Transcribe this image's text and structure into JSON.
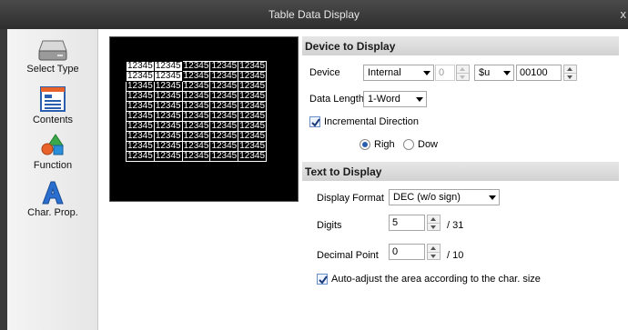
{
  "window": {
    "title": "Table Data Display",
    "close_glyph": "x"
  },
  "sidebar": {
    "items": [
      {
        "label": "Select Type",
        "icon": "drive-icon"
      },
      {
        "label": "Contents",
        "icon": "contents-icon"
      },
      {
        "label": "Function",
        "icon": "function-icon"
      },
      {
        "label": "Char. Prop.",
        "icon": "char-prop-icon"
      }
    ]
  },
  "preview": {
    "cell_text": "12345",
    "rows": 10,
    "cols": 5
  },
  "device_section": {
    "header": "Device to Display",
    "device_label": "Device",
    "device_type": "Internal",
    "station_value": "0",
    "device_prefix": "$u",
    "address": "00100",
    "data_length_label": "Data Length",
    "data_length": "1-Word",
    "incremental_label": "Incremental Direction",
    "incremental_checked": true,
    "direction_right": "Righ",
    "direction_down": "Dow",
    "direction_selected": "right"
  },
  "text_section": {
    "header": "Text to Display",
    "format_label": "Display Format",
    "format_value": "DEC (w/o sign)",
    "digits_label": "Digits",
    "digits_value": "5",
    "digits_max": "/ 31",
    "decimal_label": "Decimal Point",
    "decimal_value": "0",
    "decimal_max": "/ 10",
    "autoadjust_label": "Auto-adjust the area according to the char. size",
    "autoadjust_checked": true
  }
}
